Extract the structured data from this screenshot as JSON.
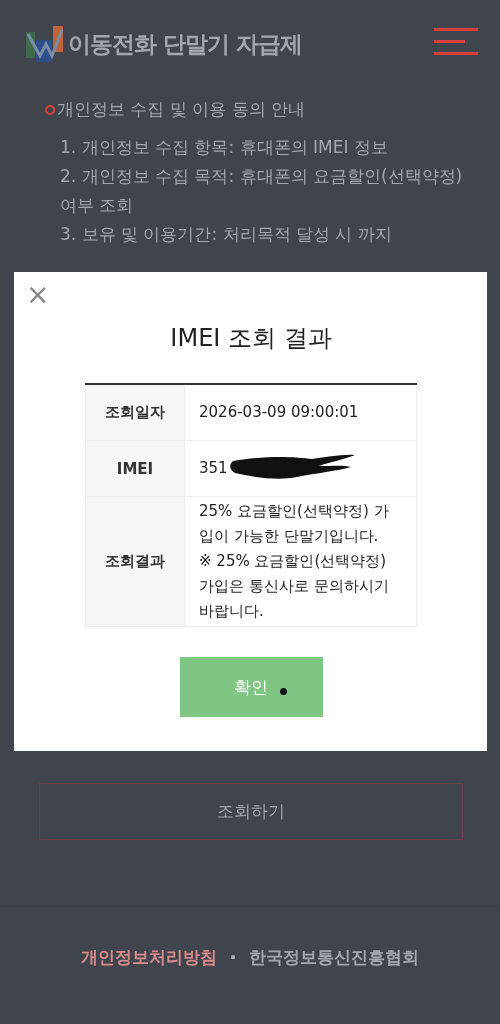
{
  "header": {
    "logo_text": "이동전화 단말기 자급제"
  },
  "notice": {
    "heading": "개인정보 수집 및 이용 동의 안내",
    "items": [
      "1. 개인정보 수집 항목: 휴대폰의 IMEI 정보",
      "2. 개인정보 수집 목적: 휴대폰의 요금할인(선택약정) 여부 조회",
      "3. 보유 및 이용기간: 처리목적 달성 시 까지"
    ]
  },
  "submit_button": "조회하기",
  "footer": {
    "links": [
      {
        "label": "개인정보처리방침",
        "kind": "highlight"
      },
      {
        "label": "한국정보통신진흥협회",
        "kind": "plain"
      }
    ],
    "separator": "·"
  },
  "modal": {
    "close": "×",
    "title": "IMEI 조회 결과",
    "rows": [
      {
        "label": "조회일자",
        "value_lines": [
          "2026-03-09 09:00:01"
        ],
        "redacted": false
      },
      {
        "label": "IMEI",
        "value_lines": [
          "351"
        ],
        "redacted": true
      },
      {
        "label": "조회결과",
        "value_lines": [
          "25% 요금할인(선택약정) 가입이 가능한 단말기입니다.",
          "※ 25% 요금할인(선택약정) 가입은 통신사로 문의하시기 바랍니다."
        ],
        "redacted": false
      }
    ],
    "button": "확인"
  }
}
